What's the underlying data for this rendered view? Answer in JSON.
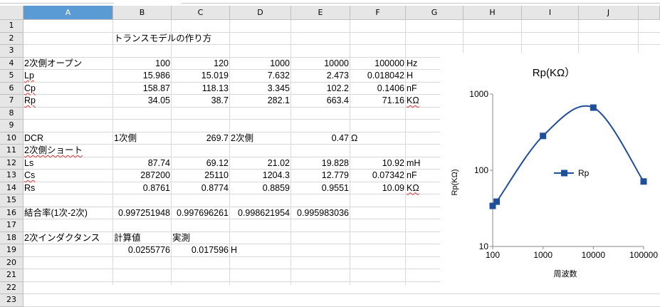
{
  "columns": [
    "A",
    "B",
    "C",
    "D",
    "E",
    "F",
    "G",
    "H",
    "I",
    "J"
  ],
  "selected_column": "A",
  "rows": [
    "1",
    "2",
    "3",
    "4",
    "5",
    "6",
    "7",
    "8",
    "9",
    "10",
    "11",
    "12",
    "13",
    "14",
    "15",
    "16",
    "17",
    "18",
    "19",
    "20",
    "21",
    "22",
    "23"
  ],
  "cells": {
    "B2": "トランスモデルの作り方",
    "A4": "2次側オープン",
    "B4": "100",
    "C4": "120",
    "D4": "1000",
    "E4": "10000",
    "F4": "100000",
    "G4": "Hz",
    "A5": "Lp",
    "B5": "15.986",
    "C5": "15.019",
    "D5": "7.632",
    "E5": "2.473",
    "F5": "0.018042",
    "G5": "H",
    "A6": "Cp",
    "B6": "158.87",
    "C6": "118.13",
    "D6": "3.345",
    "E6": "102.2",
    "F6": "0.1406",
    "G6": "nF",
    "A7": "Rp",
    "B7": "34.05",
    "C7": "38.7",
    "D7": "282.1",
    "E7": "663.4",
    "F7": "71.16",
    "G7": "KΩ",
    "A10": "DCR",
    "B10": "1次側",
    "C10": "269.7",
    "D10": "2次側",
    "E10": "0.47",
    "F10": "Ω",
    "A11": "2次側ショート",
    "A12": "Ls",
    "B12": "87.74",
    "C12": "69.12",
    "D12": "21.02",
    "E12": "19.828",
    "F12": "10.92",
    "G12": "mH",
    "A13": "Cs",
    "B13": "287200",
    "C13": "25110",
    "D13": "1204.3",
    "E13": "12.779",
    "F13": "0.07342",
    "G13": "nF",
    "A14": "Rs",
    "B14": "0.8761",
    "C14": "0.8774",
    "D14": "0.8859",
    "E14": "0.9551",
    "F14": "10.09",
    "G14": "KΩ",
    "A16": "結合率(1次-2次)",
    "B16": "0.997251948",
    "C16": "0.997696261",
    "D16": "0.998621954",
    "E16": "0.995983036",
    "A18": "2次インダクタンス",
    "B18": "計算値",
    "C18": "実測",
    "B19": "0.0255776",
    "C19": "0.017596",
    "D19": "H"
  },
  "chart_data": {
    "type": "scatter",
    "title": "Rp(KΩ）",
    "xlabel": "周波数",
    "ylabel": "Rp(KΩ)",
    "x_scale": "log",
    "y_scale": "log",
    "xlim": [
      100,
      100000
    ],
    "ylim": [
      10,
      1000
    ],
    "x_ticks": [
      "100",
      "1000",
      "10000",
      "100000"
    ],
    "y_ticks": [
      "1000",
      "100",
      "10"
    ],
    "legend_position": "center",
    "smooth_line": true,
    "series": [
      {
        "name": "Rp",
        "color": "#1f4e9a",
        "x": [
          100,
          120,
          1000,
          10000,
          100000
        ],
        "y": [
          34.05,
          38.7,
          282.1,
          663.4,
          71.16
        ]
      }
    ]
  }
}
